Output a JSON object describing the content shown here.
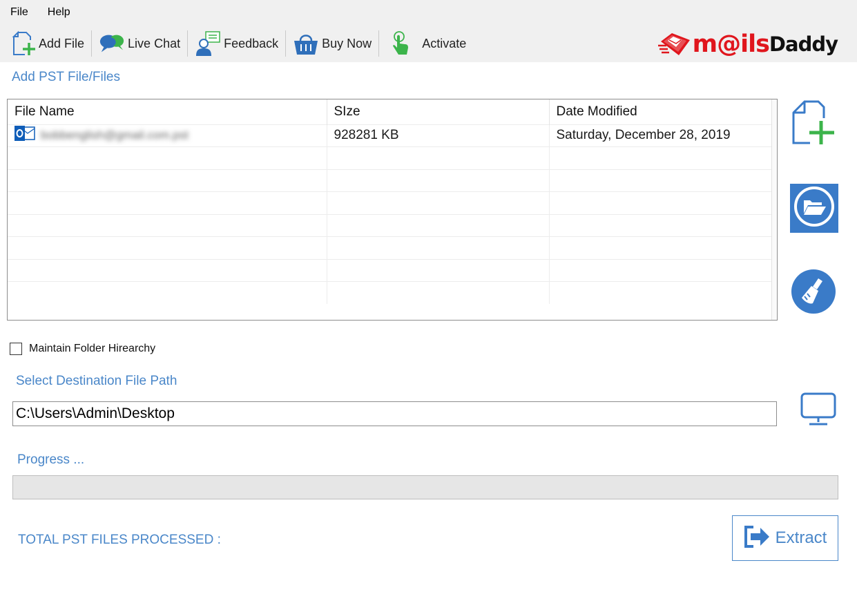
{
  "menu": {
    "items": [
      "File",
      "Help"
    ]
  },
  "toolbar": {
    "buttons": [
      {
        "label": "Add File",
        "icon": "add-file-icon"
      },
      {
        "label": "Live Chat",
        "icon": "chat-bubbles-icon"
      },
      {
        "label": "Feedback",
        "icon": "feedback-person-icon"
      },
      {
        "label": "Buy Now",
        "icon": "shopping-basket-icon"
      },
      {
        "label": "Activate",
        "icon": "tap-finger-icon"
      }
    ]
  },
  "logo": {
    "part1": "m@ils",
    "part2": "Daddy"
  },
  "add_section": {
    "label": "Add PST File/Files"
  },
  "file_table": {
    "columns": [
      "File Name",
      "SIze",
      "Date Modified"
    ],
    "rows": [
      {
        "file_name": "bobbenglish@gmail.com.pst",
        "size": "928281 KB",
        "date_modified": "Saturday, December 28, 2019",
        "icon": "outlook-file-icon"
      }
    ],
    "empty_rows": 7
  },
  "side_buttons": [
    "add-file-icon",
    "open-folder-icon",
    "clear-broom-icon"
  ],
  "options": {
    "maintain_folder_hierarchy_label": "Maintain Folder Hirearchy",
    "maintain_folder_hierarchy_checked": false
  },
  "destination": {
    "label": "Select Destination File Path",
    "path": "C:\\Users\\Admin\\Desktop",
    "browse_icon": "monitor-icon"
  },
  "progress": {
    "label": "Progress ...",
    "value_percent": 0
  },
  "footer": {
    "total_label": "TOTAL PST FILES PROCESSED :"
  },
  "extract": {
    "label": "Extract",
    "icon": "extract-arrow-icon"
  },
  "colors": {
    "accent": "#4a87c9",
    "icon_blue": "#3a7bc8",
    "icon_green": "#3cb44b",
    "logo_red": "#e0161d"
  }
}
